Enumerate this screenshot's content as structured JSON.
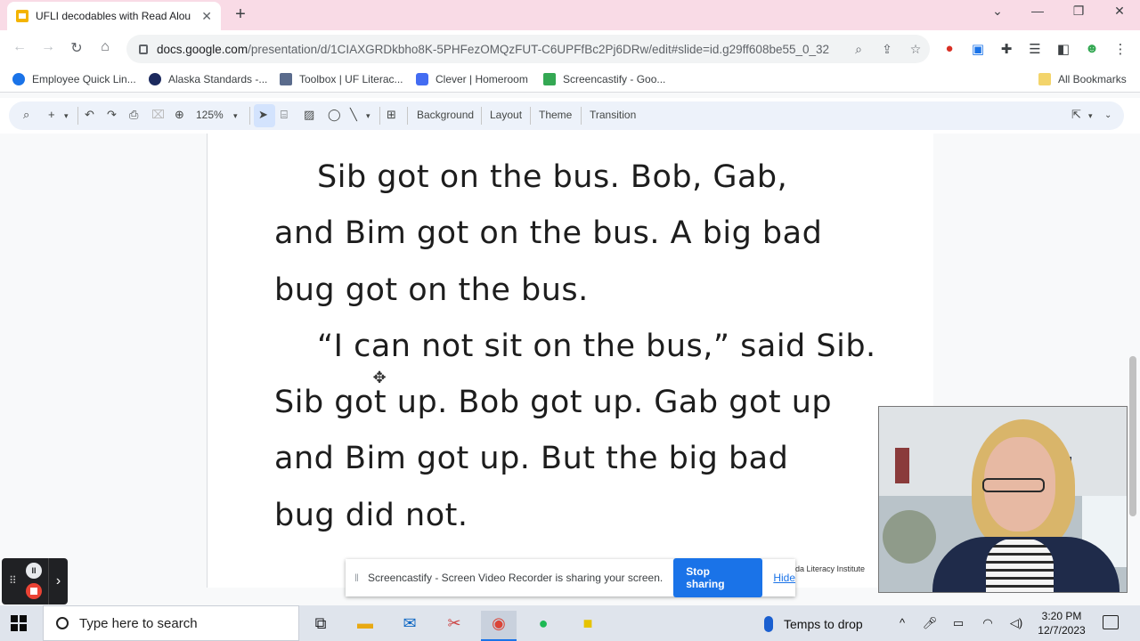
{
  "browser": {
    "tab": {
      "title": "UFLI decodables with Read Alou",
      "close": "✕"
    },
    "new_tab": "+",
    "window_controls": {
      "collapse": "⌄",
      "minimize": "—",
      "restore": "❐",
      "close": "✕"
    },
    "nav": {
      "back": "←",
      "forward": "→",
      "reload": "↻",
      "home": "⌂"
    },
    "url_host": "docs.google.com",
    "url_path": "/presentation/d/1CIAXGRDkbho8K-5PHFezOMQzFUT-C6UPFfBc2Pj6DRw/edit#slide=id.g29ff608be55_0_32",
    "bookmarks": [
      {
        "label": "Employee Quick Lin...",
        "color": "#1a73e8"
      },
      {
        "label": "Alaska Standards -...",
        "color": "#1c2a5e"
      },
      {
        "label": "Toolbox | UF Literac...",
        "color": "#5a6b8c"
      },
      {
        "label": "Clever | Homeroom",
        "color": "#436cf2"
      },
      {
        "label": "Screencastify - Goo...",
        "color": "#34a853"
      }
    ],
    "all_bookmarks": "All Bookmarks"
  },
  "slides_toolbar": {
    "zoom": "125%",
    "background": "Background",
    "layout": "Layout",
    "theme": "Theme",
    "transition": "Transition"
  },
  "slide": {
    "lines": [
      "Sib got on the bus. Bob, Gab,",
      "and Bim got on the bus. A big bad",
      "bug got on the bus.",
      "“I can not sit on the bus,” said Sib.",
      "Sib got up. Bob got up. Gab got up",
      "and Bim got up. But the big bad",
      "bug did not."
    ],
    "footnote": "da Literacy Institute"
  },
  "screencastify": {
    "message": "Screencastify - Screen Video Recorder is sharing your screen.",
    "stop_label": "Stop sharing",
    "hide_label": "Hide"
  },
  "taskbar": {
    "search_placeholder": "Type here to search",
    "weather": "Temps to drop",
    "time": "3:20 PM",
    "date": "12/7/2023"
  }
}
